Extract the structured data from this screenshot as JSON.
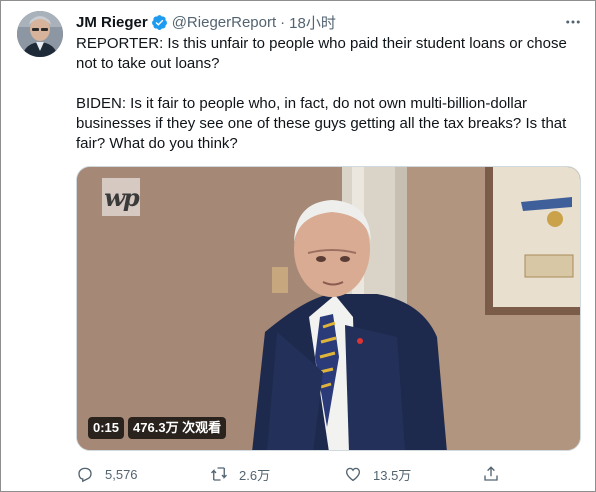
{
  "tweet": {
    "author_name": "JM Rieger",
    "handle": "@RiegerReport",
    "separator": "·",
    "time": "18小时",
    "paragraphs": [
      "REPORTER: Is this unfair to people who paid their student loans or chose not to take out loans?",
      "BIDEN: Is it fair to people who, in fact, do not own multi-billion-dollar businesses if they see one of these guys getting all the tax breaks? Is that fair? What do you think?"
    ]
  },
  "media": {
    "watermark": "wp",
    "duration": "0:15",
    "views": "476.3万 次观看"
  },
  "actions": {
    "reply_count": "5,576",
    "retweet_count": "2.6万",
    "like_count": "13.5万"
  },
  "colors": {
    "verified": "#1d9bf0",
    "muted_text": "#536471",
    "text": "#0f1419"
  },
  "icons": {
    "more": "more-horizontal-icon",
    "verified": "verified-badge-icon",
    "reply": "reply-icon",
    "retweet": "retweet-icon",
    "like": "heart-icon",
    "share": "share-icon"
  }
}
